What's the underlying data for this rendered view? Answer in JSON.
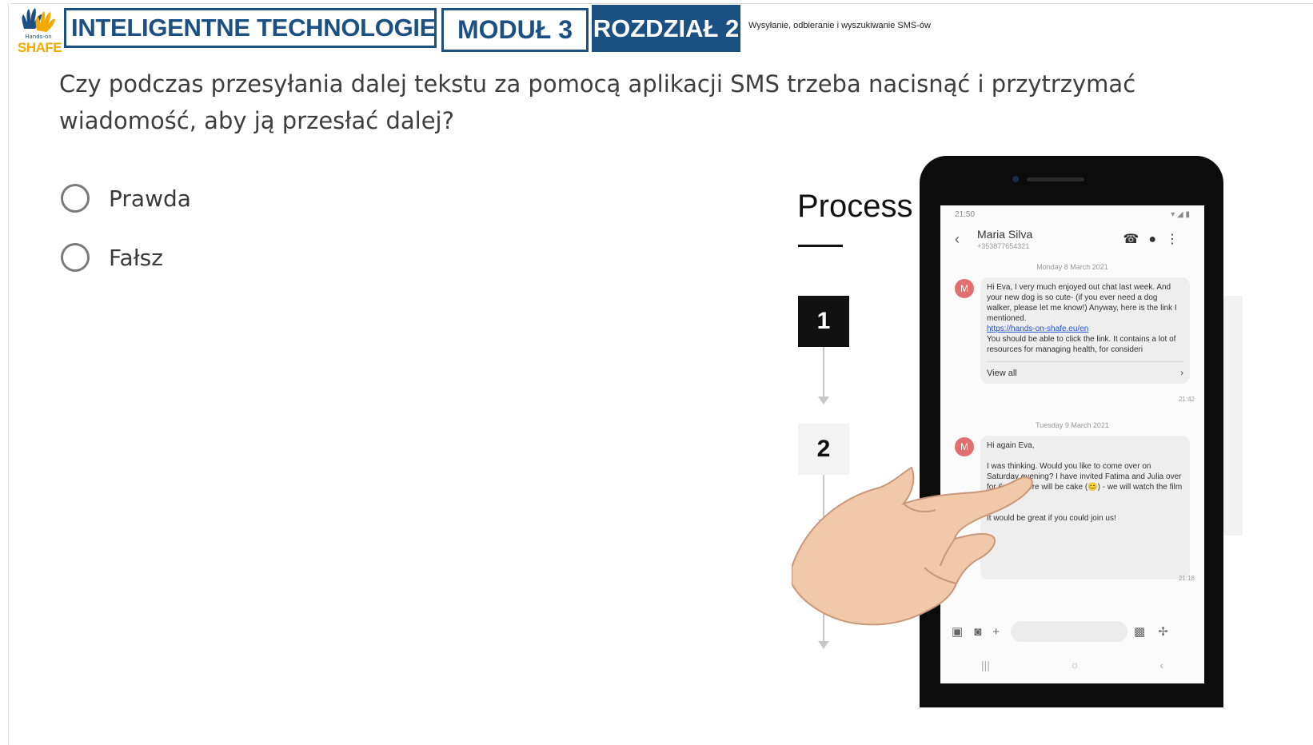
{
  "header": {
    "logo_small_text": "Hands-on",
    "logo_name": "SHAFE",
    "course_title": "INTELIGENTNE TECHNOLOGIE",
    "module_label": "MODUŁ 3",
    "chapter_label": "ROZDZIAŁ 2",
    "topic": "Wysyłanie, odbieranie i wyszukiwanie SMS-ów",
    "brand_color": "#1b5182",
    "logo_color": "#f2a900"
  },
  "quiz": {
    "question": "Czy podczas przesyłania dalej tekstu za pomocą aplikacji SMS trzeba nacisnąć i przytrzymać wiadomość, aby ją przesłać dalej?",
    "options": [
      {
        "label": "Prawda",
        "selected": false
      },
      {
        "label": "Fałsz",
        "selected": false
      }
    ]
  },
  "illustration": {
    "process_title": "Process",
    "steps": [
      "1",
      "2"
    ],
    "phone": {
      "status_time": "21:50",
      "contact_name": "Maria Silva",
      "contact_number": "+353877654321",
      "messages": [
        {
          "date": "Monday 8 March 2021",
          "avatar": "M",
          "text": "Hi Eva, I very much enjoyed out chat last week. And your new dog is so cute- (if you ever need a dog walker, please let me know!) Anyway, here is the link I mentioned.",
          "link": "https://hands-on-shafe.eu/en",
          "text_after": "You should be able to click the link. It contains a lot of resources for managing health, for consideri",
          "view_all": "View all",
          "time": "21:42"
        },
        {
          "date": "Tuesday 9 March 2021",
          "avatar": "M",
          "greeting": "Hi again Eva,",
          "text": "I was thinking. Would you like to come over on Saturday evening? I have invited Fatima and Julia over for 6pm - there will be cake (😊) - we will watch the film together.",
          "closing": "It would be great if you could join us!",
          "time": "21:18"
        }
      ]
    }
  }
}
